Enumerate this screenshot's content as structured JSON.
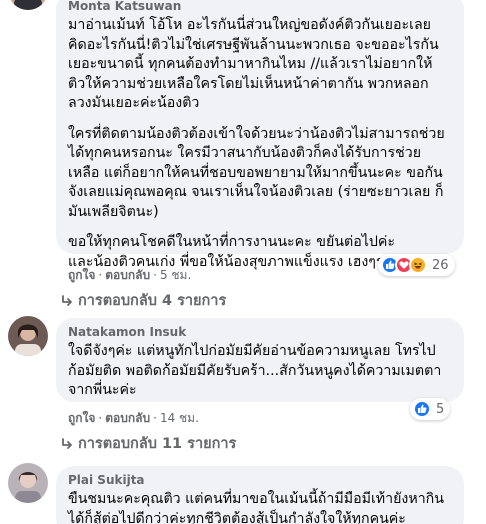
{
  "comments": [
    {
      "author": "Monta Katsuwan",
      "paragraphs": [
        [
          "มาอ่านเม้นท์ โอ้โห อะไรกันนี่ส่วนใหญ่ขอดังค์ติวกันเยอะเลย",
          "คิดอะไรกันนี่!ติวไม่ใช่เศรษฐีพันล้านนะพวกเธอ จะขออะไรกัน",
          "เยอะขนาดนี้ ทุกคนต้องทำมาหากินไหม //แล้วเราไม่อยากให้",
          "ติวให้ความช่วยเหลือใครโดยไม่เห็นหน้าค่าตากัน พวกหลอก",
          "ลวงมันเยอะค่ะน้องติว"
        ],
        [
          "ใครที่ติดตามน้องติวต้องเข้าใจด้วยนะว่าน้องติวไม่สามารถช่วย",
          "ได้ทุกคนหรอกนะ ใครมีวาสนากับน้องติวก็คงได้รับการช่วย",
          "เหลือ แต่ก็อยากให้คนที่ชอบขอพยายามให้มากขึ้นนะคะ ขอกัน",
          "จังเลยแม่คุณพอคุณ จนเราเห็นใจน้องติวเลย (ร่ายซะยาวเลย ก็",
          "มันเพลียจิตนะ)"
        ],
        [
          "ขอให้ทุกคนโชคดีในหน้าที่การงานนะคะ ขยันต่อไปค่ะ",
          "และน้องติวคนเก่ง พี่ขอให้น้องสุขภาพแข็งแรง เฮงๆรวยๆนะคะ"
        ]
      ],
      "like_label": "ถูกใจ",
      "reply_label": "ตอบกลับ",
      "time": "5 ชม.",
      "reaction_count": "26",
      "replies_label": "การตอบกลับ 4 รายการ"
    },
    {
      "author": "Natakamon Insuk",
      "paragraphs": [
        [
          "ใจดีจังๆค่ะ แต่หนูทักไปก่อมัยมีคัยอ่านข้อความหนูเลย โทรไป",
          "ก้อมัยติด พอติดก้อมัยมีคัยรับคร้า...สักวันหนูคงได้ความเมตตา",
          "จากพี่นะค่ะ"
        ]
      ],
      "like_label": "ถูกใจ",
      "reply_label": "ตอบกลับ",
      "time": "14 ชม.",
      "reaction_count": "5",
      "replies_label": "การตอบกลับ 11 รายการ"
    },
    {
      "author": "Plai Sukijta",
      "paragraphs": [
        [
          "ขืนชมนะคะคุณติว แต่คนที่มาขอในเม้นนี้ถ้ามีมือมีเท้ายังหากิน",
          "ได้ก็สู้ต่อไปดีกว่าค่ะทุกชีวิตต้องสู้เป็นกำลังใจให้ทุกคนค่ะ"
        ]
      ]
    }
  ],
  "colors": {
    "bubble": "#f0f2f5",
    "secondary_text": "#65676b",
    "like_blue": "#1877f2",
    "love_red": "#f33e58",
    "haha_yellow": "#f7b125"
  }
}
